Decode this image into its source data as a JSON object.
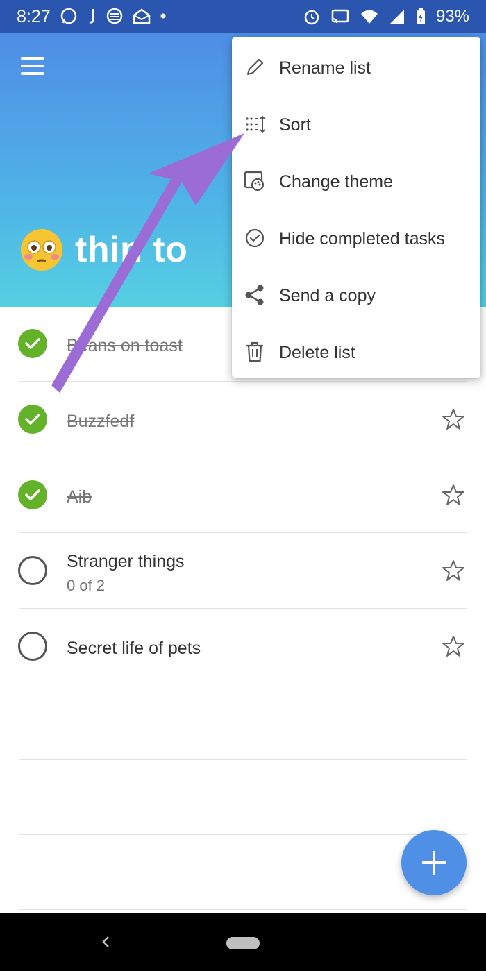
{
  "status_bar": {
    "time": "8:27",
    "battery": "93%",
    "left_icons": [
      "whatsapp-icon",
      "j-icon",
      "layers-icon",
      "mail-open-icon",
      "dot-icon"
    ],
    "right_icons": [
      "alarm-icon",
      "cast-icon",
      "wifi-icon",
      "signal-icon",
      "battery-icon"
    ]
  },
  "header": {
    "emoji": "😳",
    "title": "thin  to",
    "gradient": [
      "#4f8de6",
      "#55cfe2"
    ]
  },
  "tasks": [
    {
      "label": "Beans on toast",
      "done": true,
      "starred": false
    },
    {
      "label": "Buzzfedf",
      "done": true,
      "starred": false
    },
    {
      "label": "Aib",
      "done": true,
      "starred": false
    },
    {
      "label": "Stranger things",
      "sub": "0 of 2",
      "done": false,
      "starred": false
    },
    {
      "label": "Secret life of pets",
      "done": false,
      "starred": false
    }
  ],
  "menu": {
    "items": [
      {
        "label": "Rename list",
        "icon": "pencil-icon"
      },
      {
        "label": "Sort",
        "icon": "sort-icon"
      },
      {
        "label": "Change theme",
        "icon": "theme-icon"
      },
      {
        "label": "Hide completed tasks",
        "icon": "check-circle-icon"
      },
      {
        "label": "Send a copy",
        "icon": "share-icon"
      },
      {
        "label": "Delete list",
        "icon": "trash-icon"
      }
    ]
  },
  "colors": {
    "check_done": "#63b229",
    "fab": "#4f8fe6",
    "arrow": "#9b6bd6"
  }
}
